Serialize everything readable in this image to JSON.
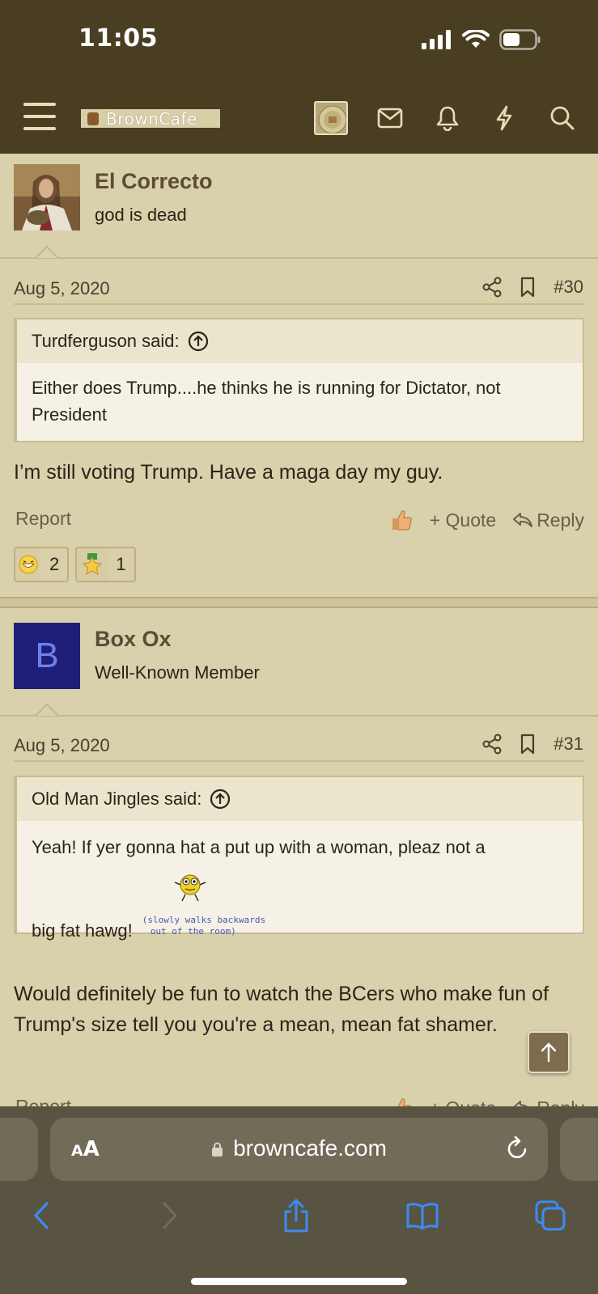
{
  "status_bar": {
    "time": "11:05"
  },
  "header": {
    "site_name": "BrownCafe",
    "icons": [
      "menu-icon",
      "mail-icon",
      "bell-icon",
      "lightning-icon",
      "search-icon"
    ]
  },
  "posts": [
    {
      "author": "El Correcto",
      "user_title": "god is dead",
      "date": "Aug 5, 2020",
      "post_number": "#30",
      "quote": {
        "author_line": "Turdferguson said:",
        "text": "Either does Trump....he thinks he is running for Dictator, not President"
      },
      "message": "I’m still voting Trump. Have a maga day my guy.",
      "actions": {
        "report": "Report",
        "quote": "Quote",
        "reply": "Reply"
      },
      "reactions": [
        {
          "icon": "laugh-emoji-icon",
          "count": "2"
        },
        {
          "icon": "star-emoji-icon",
          "count": "1"
        }
      ]
    },
    {
      "author": "Box Ox",
      "avatar_letter": "B",
      "avatar_color": "#1f1f7a",
      "user_title": "Well-Known Member",
      "date": "Aug 5, 2020",
      "post_number": "#31",
      "quote": {
        "author_line": "Old Man Jingles said:",
        "text_line1": "Yeah! If yer gonna hat a put up with a woman, pleaz not a",
        "text_line2": "big fat hawg!",
        "smiley_caption_1": "(slowly walks backwards",
        "smiley_caption_2": "out of the room)"
      },
      "message": "Would definitely be fun to watch the BCers who make fun of Trump's size tell you you're a mean, mean fat shamer.",
      "actions": {
        "report": "Report",
        "quote": "Quote",
        "reply": "Reply"
      }
    }
  ],
  "browser": {
    "aa_label_small": "A",
    "aa_label_big": "A",
    "url": "browncafe.com"
  }
}
